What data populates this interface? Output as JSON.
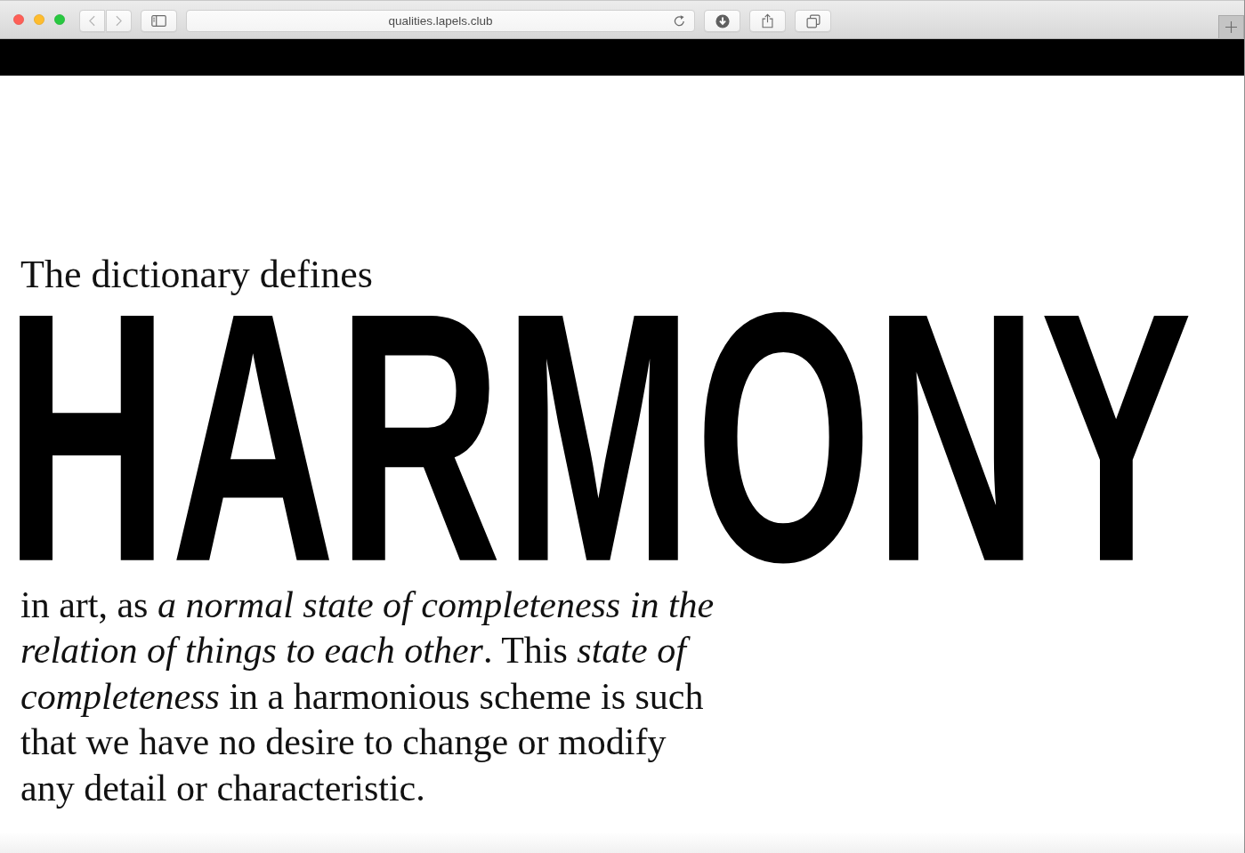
{
  "browser": {
    "url": "qualities.lapels.club"
  },
  "page": {
    "intro": "The dictionary defines",
    "headword": "HARMONY",
    "definition": "in art, as *a normal state of completeness in the relation of things to each other*. This *state of completeness* in a harmonious scheme is such that we have no desire to change or modify any detail or characteristic."
  }
}
